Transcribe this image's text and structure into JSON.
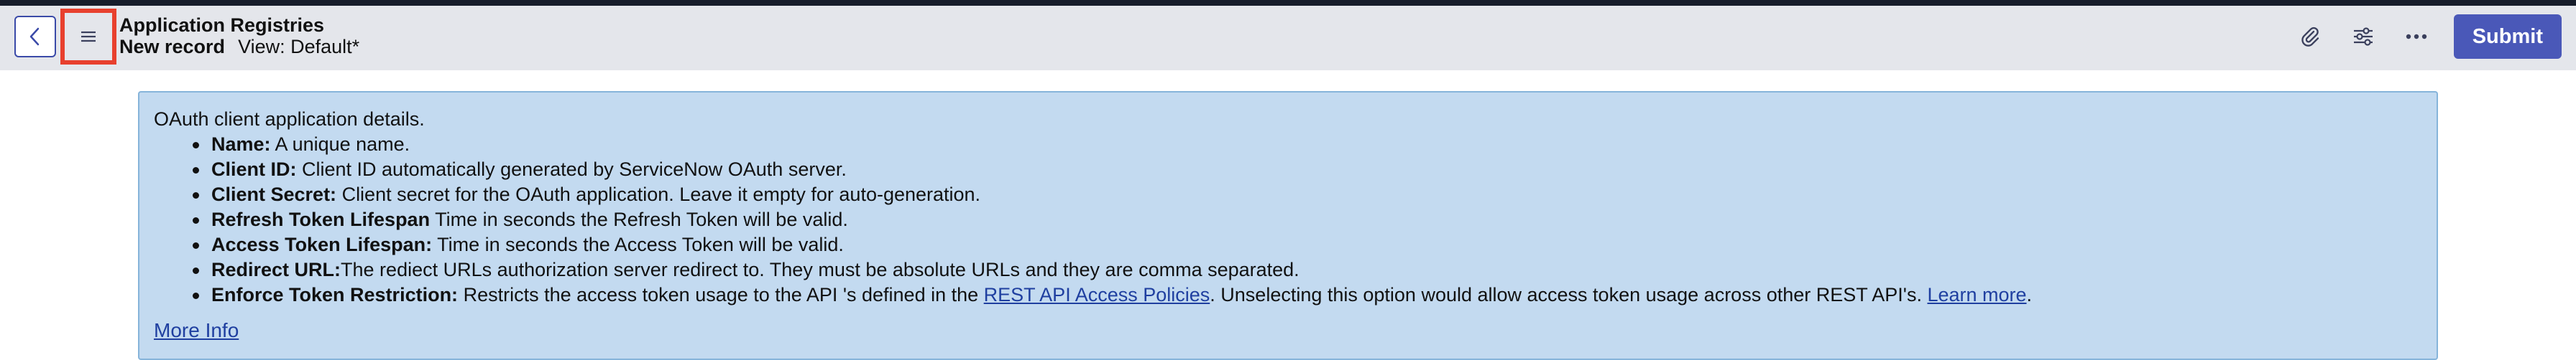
{
  "header": {
    "title": "Application Registries",
    "record": "New record",
    "view_label": "View: Default*",
    "submit_label": "Submit"
  },
  "icons": {
    "back": "chevron-left-icon",
    "menu": "hamburger-menu-icon",
    "attach": "paperclip-icon",
    "settings": "sliders-icon",
    "more": "ellipsis-icon"
  },
  "colors": {
    "accent": "#4a58b8",
    "highlight": "#e8402e",
    "info_bg": "#c3daf0",
    "info_border": "#86b4da",
    "header_bg": "#e4e6eb",
    "top_strip": "#171d2b",
    "link": "#1f3fa0"
  },
  "info": {
    "intro": "OAuth client application details.",
    "items": [
      {
        "term": "Name:",
        "desc": " A unique name."
      },
      {
        "term": "Client ID:",
        "desc": " Client ID automatically generated by ServiceNow OAuth server."
      },
      {
        "term": "Client Secret:",
        "desc": " Client secret for the OAuth application. Leave it empty for auto-generation."
      },
      {
        "term": "Refresh Token Lifespan",
        "desc": " Time in seconds the Refresh Token will be valid."
      },
      {
        "term": "Access Token Lifespan:",
        "desc": " Time in seconds the Access Token will be valid."
      },
      {
        "term": "Redirect URL:",
        "desc": "The rediect URLs authorization server redirect to. They must be absolute URLs and they are comma separated."
      }
    ],
    "last_item": {
      "term": "Enforce Token Restriction:",
      "desc_before": " Restricts the access token usage to the API 's defined in the ",
      "link1": "REST API Access Policies",
      "desc_middle": ". Unselecting this option would allow access token usage across other REST API's. ",
      "link2": "Learn more",
      "desc_after": "."
    },
    "more_info": "More Info"
  }
}
